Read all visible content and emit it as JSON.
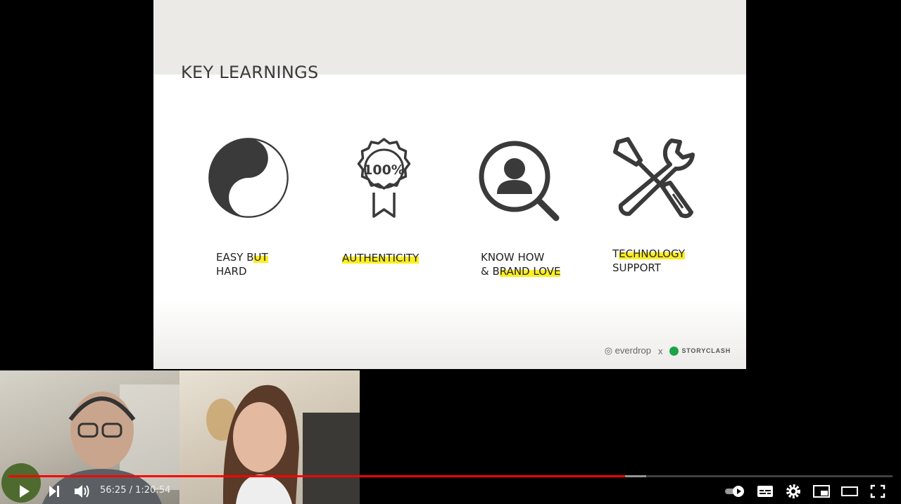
{
  "slide": {
    "title": "KEY LEARNINGS",
    "items": [
      {
        "line1": "EASY B",
        "line1_hl": "UT",
        "line2": "HARD",
        "icon": "yin-yang-icon"
      },
      {
        "line1": "",
        "line1_hl": "AUTHENTICITY",
        "line2": "",
        "icon": "badge-100-icon",
        "badge_text": "100%"
      },
      {
        "line1": "KNOW HOW",
        "line2_pre": "& B",
        "line2_hl": "RAND LOVE",
        "icon": "person-search-icon"
      },
      {
        "line1_pre": "T",
        "line1_hl": "ECHNOLOGY",
        "line2": "SUPPORT",
        "icon": "tools-icon"
      }
    ],
    "footer": {
      "brand1": "everdrop",
      "separator": "x",
      "brand2": "STORYCLASH"
    },
    "colors": {
      "highlight": "#fcee21",
      "band": "#ebeae7",
      "icon": "#3a3a3a"
    }
  },
  "player": {
    "time_current": "56:25",
    "time_total": "1:20:54",
    "time_sep": " / ",
    "progress_played": 0.6974,
    "progress_buffered": 0.7217,
    "colors": {
      "played": "#ff0000"
    },
    "controls": [
      "play-icon",
      "next-icon",
      "volume-icon",
      "autoplay-toggle-icon",
      "subtitles-icon",
      "settings-icon",
      "miniplayer-icon",
      "theater-icon",
      "fullscreen-icon"
    ]
  }
}
